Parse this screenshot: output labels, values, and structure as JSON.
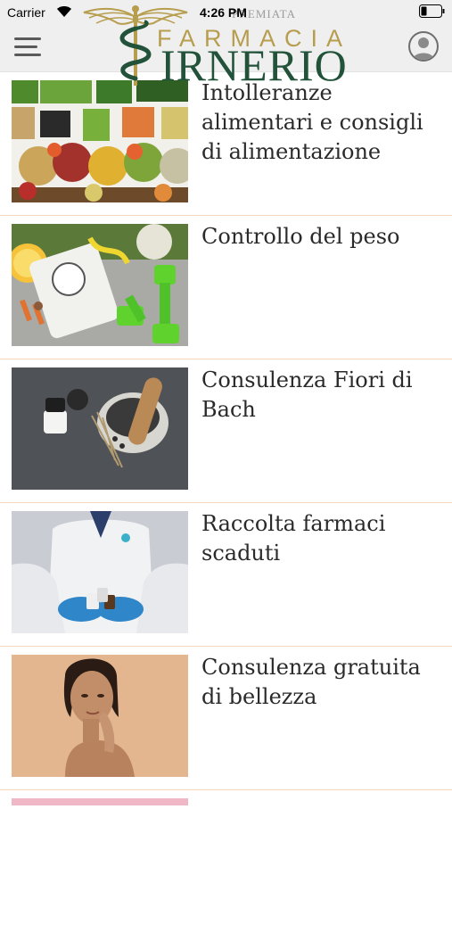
{
  "status": {
    "carrier": "Carrier",
    "time": "4:26 PM"
  },
  "header": {
    "logo_tagline": "PREMIATA",
    "logo_word1": "FARMACIA",
    "logo_word2": "IRNERIO",
    "colors": {
      "gold": "#b79e4f",
      "green": "#22533a",
      "header_bg": "#efefef"
    }
  },
  "services": [
    {
      "title": "Intolleranze alimentari e consigli di alimentazione",
      "icon": "vegetables-bowls-photo"
    },
    {
      "title": "Controllo del peso",
      "icon": "scale-and-dumbbells-photo"
    },
    {
      "title": "Consulenza Fiori di Bach",
      "icon": "mortar-and-pestle-photo"
    },
    {
      "title": "Raccolta farmaci scaduti",
      "icon": "pharmacist-holding-medicines-photo"
    },
    {
      "title": "Consulenza gratuita di bellezza",
      "icon": "woman-portrait-photo"
    }
  ],
  "divider_color": "#f3d7bf"
}
